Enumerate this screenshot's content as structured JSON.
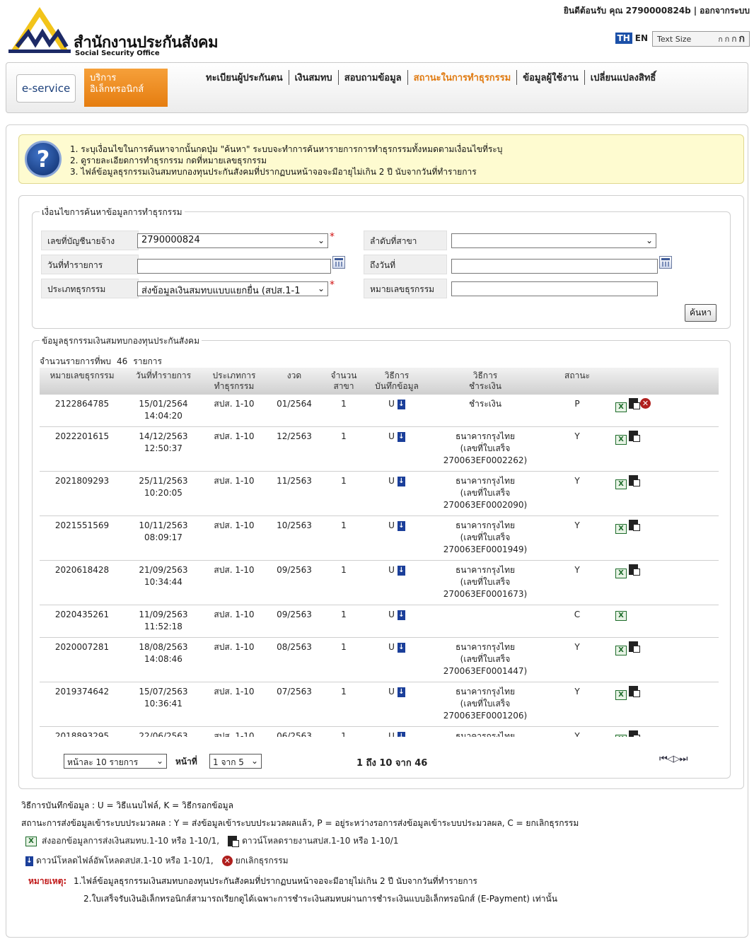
{
  "header": {
    "welcome": "ยินดีต้อนรับ คุณ 2790000824b",
    "logout": "ออกจากระบบ",
    "logo_th": "สำนักงานประกันสังคม",
    "logo_en": "Social Security Office",
    "lang_th": "TH",
    "lang_en": "EN",
    "text_size_label": "Text Size",
    "text_sizes": [
      "ก",
      "ก",
      "ก",
      "ก"
    ]
  },
  "nav": {
    "eservice": "e-service",
    "borikan_line1": "บริการ",
    "borikan_line2": "อิเล็กทรอนิกส์",
    "menu": [
      {
        "label": "ทะเบียนผู้ประกันตน",
        "active": false
      },
      {
        "label": "เงินสมทบ",
        "active": false
      },
      {
        "label": "สอบถามข้อมูล",
        "active": false
      },
      {
        "label": "สถานะในการทำธุรกรรม",
        "active": true
      },
      {
        "label": "ข้อมูลผู้ใช้งาน",
        "active": false
      },
      {
        "label": "เปลี่ยนแปลงสิทธิ์",
        "active": false
      }
    ]
  },
  "help": {
    "lines": [
      "1. ระบุเงื่อนไขในการค้นหาจากนั้นกดปุ่ม \"ค้นหา\" ระบบจะทำการค้นหารายการการทำธุรกรรมทั้งหมดตามเงื่อนไขที่ระบุ",
      "2. ดูรายละเอียดการทำธุรกรรม กดที่หมายเลขธุรกรรม",
      "3. ไฟล์ข้อมูลธุรกรรมเงินสมทบกองทุนประกันสังคมที่ปรากฏบนหน้าจอจะมีอายุไม่เกิน 2 ปี นับจากวันที่ทำรายการ"
    ]
  },
  "search": {
    "legend": "เงื่อนไขการค้นหาข้อมูลการทำธุรกรรม",
    "employer_label": "เลขที่บัญชีนายจ้าง",
    "employer_value": "2790000824",
    "branch_label": "ลำดับที่สาขา",
    "branch_value": "",
    "date_label": "วันที่ทำรายการ",
    "date_value": "",
    "todate_label": "ถึงวันที่",
    "todate_value": "",
    "type_label": "ประเภทธุรกรรม",
    "type_value": "ส่งข้อมูลเงินสมทบแบบแยกยื่น (สปส.1-1",
    "txn_label": "หมายเลขธุรกรรม",
    "txn_value": "",
    "required_mark": "*",
    "search_button": "ค้นหา"
  },
  "results": {
    "legend": "ข้อมูลธุรกรรมเงินสมทบกองทุนประกันสังคม",
    "count_prefix": "จำนวนรายการที่พบ",
    "count": "46",
    "count_suffix": "รายการ",
    "columns": {
      "txn": "หมายเลขธุรกรรม",
      "date": "วันที่ทำรายการ",
      "type1": "ประเภทการ",
      "type2": "ทำธุรกรรม",
      "period": "งวด",
      "branch1": "จำนวน",
      "branch2": "สาขา",
      "method1": "วิธีการ",
      "method2": "บันทึกข้อมูล",
      "pay1": "วิธีการ",
      "pay2": "ชำระเงิน",
      "status": "สถานะ"
    },
    "rows": [
      {
        "txn": "2122864785",
        "date": "15/01/2564",
        "time": "14:04:20",
        "type": "สปส. 1-10",
        "period": "01/2564",
        "branches": "1",
        "method": "U",
        "pay1": "ชำระเงิน",
        "pay2": "",
        "pay3": "",
        "status": "P",
        "xl": true,
        "doc": true,
        "cancel": true
      },
      {
        "txn": "2022201615",
        "date": "14/12/2563",
        "time": "12:50:37",
        "type": "สปส. 1-10",
        "period": "12/2563",
        "branches": "1",
        "method": "U",
        "pay1": "ธนาคารกรุงไทย",
        "pay2": "(เลขที่ใบเสร็จ",
        "pay3": "270063EF0002262)",
        "status": "Y",
        "xl": true,
        "doc": true,
        "cancel": false
      },
      {
        "txn": "2021809293",
        "date": "25/11/2563",
        "time": "10:20:05",
        "type": "สปส. 1-10",
        "period": "11/2563",
        "branches": "1",
        "method": "U",
        "pay1": "ธนาคารกรุงไทย",
        "pay2": "(เลขที่ใบเสร็จ",
        "pay3": "270063EF0002090)",
        "status": "Y",
        "xl": true,
        "doc": true,
        "cancel": false
      },
      {
        "txn": "2021551569",
        "date": "10/11/2563",
        "time": "08:09:17",
        "type": "สปส. 1-10",
        "period": "10/2563",
        "branches": "1",
        "method": "U",
        "pay1": "ธนาคารกรุงไทย",
        "pay2": "(เลขที่ใบเสร็จ",
        "pay3": "270063EF0001949)",
        "status": "Y",
        "xl": true,
        "doc": true,
        "cancel": false
      },
      {
        "txn": "2020618428",
        "date": "21/09/2563",
        "time": "10:34:44",
        "type": "สปส. 1-10",
        "period": "09/2563",
        "branches": "1",
        "method": "U",
        "pay1": "ธนาคารกรุงไทย",
        "pay2": "(เลขที่ใบเสร็จ",
        "pay3": "270063EF0001673)",
        "status": "Y",
        "xl": true,
        "doc": true,
        "cancel": false
      },
      {
        "txn": "2020435261",
        "date": "11/09/2563",
        "time": "11:52:18",
        "type": "สปส. 1-10",
        "period": "09/2563",
        "branches": "1",
        "method": "U",
        "pay1": "",
        "pay2": "",
        "pay3": "",
        "status": "C",
        "xl": true,
        "doc": false,
        "cancel": false
      },
      {
        "txn": "2020007281",
        "date": "18/08/2563",
        "time": "14:08:46",
        "type": "สปส. 1-10",
        "period": "08/2563",
        "branches": "1",
        "method": "U",
        "pay1": "ธนาคารกรุงไทย",
        "pay2": "(เลขที่ใบเสร็จ",
        "pay3": "270063EF0001447)",
        "status": "Y",
        "xl": true,
        "doc": true,
        "cancel": false
      },
      {
        "txn": "2019374642",
        "date": "15/07/2563",
        "time": "10:36:41",
        "type": "สปส. 1-10",
        "period": "07/2563",
        "branches": "1",
        "method": "U",
        "pay1": "ธนาคารกรุงไทย",
        "pay2": "(เลขที่ใบเสร็จ",
        "pay3": "270063EF0001206)",
        "status": "Y",
        "xl": true,
        "doc": true,
        "cancel": false
      },
      {
        "txn": "2018893295",
        "date": "22/06/2563",
        "time": "",
        "type": "สปส. 1-10",
        "period": "06/2563",
        "branches": "1",
        "method": "U",
        "pay1": "ธนาคารกรุงไทย",
        "pay2": "",
        "pay3": "",
        "status": "Y",
        "xl": true,
        "doc": true,
        "cancel": false
      }
    ]
  },
  "pager": {
    "per_page": "หน้าละ 10 รายการ",
    "page_label": "หน้าที่",
    "page_value": "1 จาก 5",
    "range": "1 ถึง 10 จาก 46",
    "nav": "⏮◁▷⏭"
  },
  "legend_notes": {
    "method_note": "วิธีการบันทึกข้อมูล : U = วิธีแนบไฟล์, K = วิธีกรอกข้อมูล",
    "status_note": "สถานะการส่งข้อมูลเข้าระบบประมวลผล : Y = ส่งข้อมูลเข้าระบบประมวลผลแล้ว, P = อยู่ระหว่างรอการส่งข้อมูลเข้าระบบประมวลผล, C = ยกเลิกธุรกรรม",
    "xl_note": "ส่งออกข้อมูลการส่งเงินสมทบ.1-10 หรือ 1-10/1,",
    "doc_note": "ดาวน์โหลดรายงานสปส.1-10 หรือ 1-10/1",
    "dl_note": "ดาวน์โหลดไฟล์อัพโหลดสปส.1-10 หรือ 1-10/1,",
    "cancel_note": "ยกเลิกธุรกรรม",
    "remark_title": "หมายเหตุ:",
    "remark1": "1.ไฟล์ข้อมูลธุรกรรมเงินสมทบกองทุนประกันสังคมที่ปรากฏบนหน้าจอจะมีอายุไม่เกิน 2 ปี นับจากวันที่ทำรายการ",
    "remark2": "2.ใบเสร็จรับเงินอิเล็กทรอนิกส์สามารถเรียกดูได้เฉพาะการชำระเงินสมทบผ่านการชำระเงินแบบอิเล็กทรอนิกส์ (E-Payment) เท่านั้น"
  },
  "colors": {
    "accent": "#e07a10",
    "th_badge": "#1b50a8",
    "help_bg": "#fefbd0",
    "required": "#d01010"
  }
}
